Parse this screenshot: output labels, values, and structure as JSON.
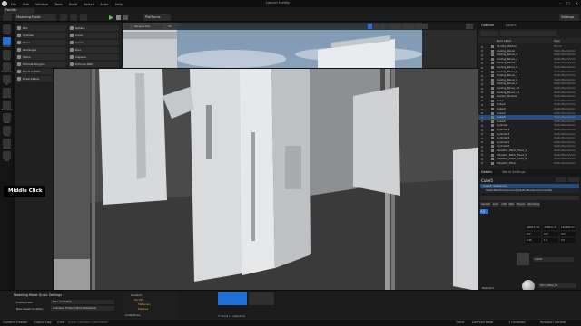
{
  "titlebar": {
    "menu": [
      "File",
      "Edit",
      "Window",
      "Tools",
      "Build",
      "Select",
      "Actor",
      "Help"
    ],
    "project": "Launch Facility",
    "window_controls": [
      "minimize-icon",
      "maximize-icon",
      "close-icon"
    ]
  },
  "level_tab": "Facility",
  "toolbar": {
    "mode": "Modeling Mode",
    "platforms": "Platforms",
    "settings": "Settings"
  },
  "left_strip": {
    "labels": [
      "Select",
      "Create",
      "Model",
      "PolyGroup",
      "Tri",
      "Deform",
      "Transform",
      "Mesh",
      "Voxel",
      "Attribs",
      "UVs",
      "Baking",
      "Volumes",
      "LODs"
    ]
  },
  "tools": {
    "items": [
      [
        "Box",
        "Sphere"
      ],
      [
        "Cylinder",
        "Cone"
      ],
      [
        "Torus",
        "Arrow"
      ],
      [
        "Rectangle",
        "Disc"
      ],
      [
        "Stairs",
        "Capsule"
      ],
      [
        "Extrude Polygon",
        "Extrude Path"
      ],
      [
        "Revolve Path",
        ""
      ],
      [
        "Draw Spline",
        ""
      ]
    ]
  },
  "viewport": {
    "view_mode": "Perspective",
    "lit_mode": "Lit"
  },
  "keypress": {
    "label": "Middle Click"
  },
  "outliner": {
    "tabs": [
      "Outliner",
      "Layers"
    ],
    "filter_label": "Facility (Editor)",
    "columns": [
      "Item Label",
      "Type"
    ],
    "rows": [
      {
        "label": "Facility (Editor)",
        "type": "World"
      },
      {
        "label": "Ceiling_Panel",
        "type": "StaticMeshActor"
      },
      {
        "label": "Ceiling_Panel_2",
        "type": "StaticMeshActor"
      },
      {
        "label": "Ceiling_Panel_3",
        "type": "StaticMeshActor"
      },
      {
        "label": "Ceiling_Panel_4",
        "type": "StaticMeshActor"
      },
      {
        "label": "Ceiling_Panel_5",
        "type": "StaticMeshActor"
      },
      {
        "label": "Ceiling_Panel_6",
        "type": "StaticMeshActor"
      },
      {
        "label": "Ceiling_Panel_7",
        "type": "StaticMeshActor"
      },
      {
        "label": "Ceiling_Panel_8",
        "type": "StaticMeshActor"
      },
      {
        "label": "Ceiling_Panel_9",
        "type": "StaticMeshActor"
      },
      {
        "label": "Ceiling_Panel_10",
        "type": "StaticMeshActor"
      },
      {
        "label": "Ceiling_Panel_11",
        "type": "StaticMeshActor"
      },
      {
        "label": "Center_Module",
        "type": "StaticMeshActor"
      },
      {
        "label": "Cube",
        "type": "StaticMeshActor"
      },
      {
        "label": "Cube2",
        "type": "StaticMeshActor"
      },
      {
        "label": "Cube3",
        "type": "StaticMeshActor"
      },
      {
        "label": "Cube4",
        "type": "StaticMeshActor"
      },
      {
        "label": "Cube5",
        "type": "StaticMeshActor"
      },
      {
        "label": "Cube6",
        "type": "StaticMeshActor"
      },
      {
        "label": "Cylinder",
        "type": "StaticMeshActor"
      },
      {
        "label": "Cylinder2",
        "type": "StaticMeshActor"
      },
      {
        "label": "Cylinder3",
        "type": "StaticMeshActor"
      },
      {
        "label": "Cylinder4",
        "type": "StaticMeshActor"
      },
      {
        "label": "Cylinder5",
        "type": "StaticMeshActor"
      },
      {
        "label": "Cylinder6",
        "type": "StaticMeshActor"
      },
      {
        "label": "Elevator_Pillar_Tiled_4",
        "type": "StaticMeshActor"
      },
      {
        "label": "Elevator_Pillar_Tiled_5",
        "type": "StaticMeshActor"
      },
      {
        "label": "Elevator_Pillar_Tiled_6",
        "type": "StaticMeshActor"
      },
      {
        "label": "Elevator_Pillar",
        "type": "StaticMeshActor"
      }
    ],
    "selected_index": 17,
    "count": "3 items (1 selected)"
  },
  "details": {
    "tabs": [
      "Details",
      "World Settings"
    ],
    "object_name": "Cube5",
    "component": "Cube5 (Instance)",
    "subcomponent": "StaticMeshComponent (StaticMeshComponent0)",
    "filter_tabs": [
      "General",
      "Actor",
      "LOD",
      "Misc",
      "Physics",
      "Rendering",
      "Streaming",
      "All"
    ],
    "transform": {
      "location": [
        "-2662.0 cm",
        "-3160.0 cm",
        "110.000 cm"
      ],
      "rotation": [
        "0.0°",
        "0.0°",
        "0.0°"
      ],
      "scale": [
        "2.25",
        "1.0",
        "3.5"
      ]
    },
    "mesh_label": "Cube5",
    "material_label": "Element 0",
    "material_value": "Worn_Metal_01"
  },
  "bottom": {
    "quick_settings_title": "Modeling Mode Quick Settings",
    "editing_lod_label": "Editing LOD",
    "editing_lod_value": "Max Available",
    "asset_location_label": "New Asset Location",
    "asset_location_value": "AutoGen Folder (World-Relative)",
    "content_browser": "Content Browser",
    "collections": "Collections",
    "folders": [
      "Content",
      "Facility",
      "Materials",
      "Meshes"
    ],
    "item_count": "3 items (1 selected)"
  },
  "statusbar": {
    "content_drawer": "Content Drawer",
    "output_log": "Output Log",
    "cmd": "Cmd",
    "cmd_placeholder": "Enter Console Command",
    "trace": "Trace",
    "derived_data": "Derived Data",
    "unsaved": "1 Unsaved",
    "revision": "Revision Control"
  },
  "colors": {
    "accent": "#2a6fd6",
    "selection": "#254d80",
    "panel": "#1f1f1f",
    "sky": "#8fa9c0",
    "asset_tile": "#1e6fd8"
  }
}
